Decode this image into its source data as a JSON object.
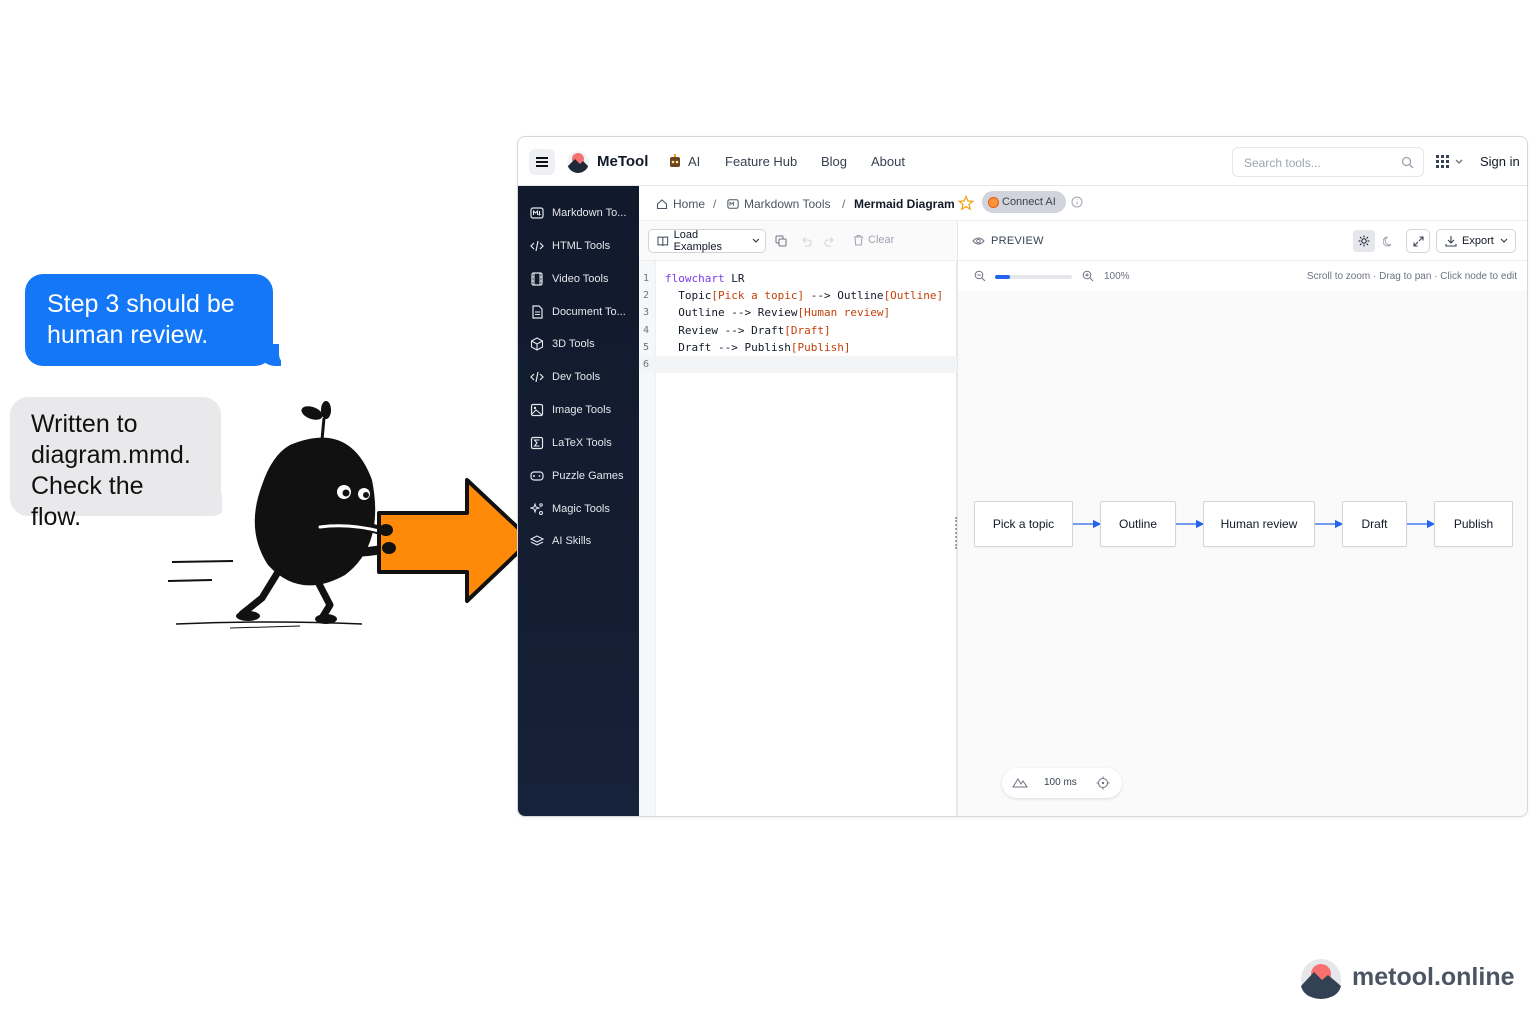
{
  "chat": {
    "outgoing": "Step 3 should be human review.",
    "incoming": [
      "Written to",
      "diagram.mmd.",
      "Check the flow."
    ]
  },
  "topbar": {
    "brand": "MeTool",
    "nav": [
      "AI",
      "Feature Hub",
      "Blog",
      "About"
    ],
    "search_placeholder": "Search tools...",
    "sign_in": "Sign in"
  },
  "sidebar": {
    "items": [
      {
        "label": "Markdown To...",
        "icon": "markdown-icon"
      },
      {
        "label": "HTML Tools",
        "icon": "code-icon"
      },
      {
        "label": "Video Tools",
        "icon": "film-icon"
      },
      {
        "label": "Document To...",
        "icon": "document-icon"
      },
      {
        "label": "3D Tools",
        "icon": "cube-icon"
      },
      {
        "label": "Dev Tools",
        "icon": "code-icon"
      },
      {
        "label": "Image Tools",
        "icon": "image-icon"
      },
      {
        "label": "LaTeX Tools",
        "icon": "sigma-icon"
      },
      {
        "label": "Puzzle Games",
        "icon": "gamepad-icon"
      },
      {
        "label": "Magic Tools",
        "icon": "sparkles-icon"
      },
      {
        "label": "AI Skills",
        "icon": "layers-icon"
      }
    ]
  },
  "breadcrumb": {
    "home": "Home",
    "section": "Markdown Tools",
    "current": "Mermaid Diagram",
    "connect_ai": "Connect AI"
  },
  "editor": {
    "load_examples": "Load Examples",
    "clear": "Clear",
    "lines": [
      {
        "n": "1",
        "tokens": [
          {
            "t": "flowchart",
            "c": "kw"
          },
          {
            "t": " LR",
            "c": ""
          }
        ]
      },
      {
        "n": "2",
        "tokens": [
          {
            "t": "  Topic",
            "c": ""
          },
          {
            "t": "[Pick a topic]",
            "c": "str"
          },
          {
            "t": " --> Outline",
            "c": ""
          },
          {
            "t": "[Outline]",
            "c": "str"
          }
        ]
      },
      {
        "n": "3",
        "tokens": [
          {
            "t": "  Outline --> Review",
            "c": ""
          },
          {
            "t": "[Human review]",
            "c": "str"
          }
        ]
      },
      {
        "n": "4",
        "tokens": [
          {
            "t": "  Review --> Draft",
            "c": ""
          },
          {
            "t": "[Draft]",
            "c": "str"
          }
        ]
      },
      {
        "n": "5",
        "tokens": [
          {
            "t": "  Draft --> Publish",
            "c": ""
          },
          {
            "t": "[Publish]",
            "c": "str"
          }
        ]
      },
      {
        "n": "6",
        "tokens": []
      }
    ]
  },
  "preview": {
    "title": "PREVIEW",
    "export": "Export",
    "zoom_pct": "100%",
    "zoom_level": 0.2,
    "hint": "Scroll to zoom · Drag to pan · Click node to edit",
    "render_time": "100 ms",
    "nodes": [
      "Pick a topic",
      "Outline",
      "Human review",
      "Draft",
      "Publish"
    ],
    "edge_color": "#2563eb"
  },
  "watermark": "metool.online",
  "colors": {
    "accent": "#1477f8",
    "arrow": "#ff8a0a",
    "sidebar": "#111a2d"
  }
}
